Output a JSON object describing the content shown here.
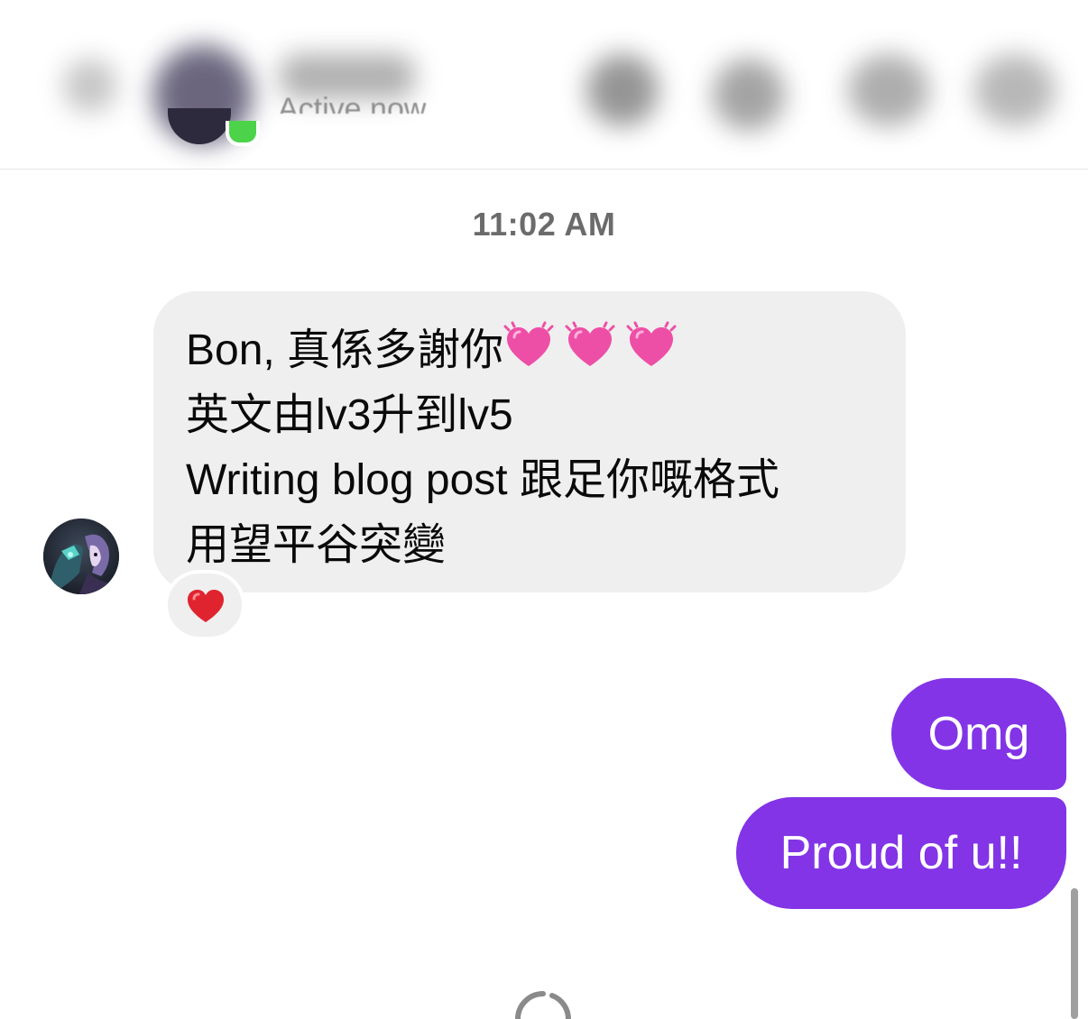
{
  "header": {
    "status": "Active now",
    "online_color": "#4cd34a",
    "icons": [
      "back-icon",
      "contact-avatar",
      "phone-icon",
      "video-icon",
      "info-icon",
      "more-icon"
    ]
  },
  "thread": {
    "timestamp": "11:02 AM",
    "incoming": {
      "lines": [
        "Bon, 真係多謝你",
        "英文由lv3升到lv5",
        "Writing blog post 跟足你嘅格式",
        "用望平谷突變"
      ],
      "trailing_emojis": [
        "growing-heart-icon",
        "growing-heart-icon",
        "growing-heart-icon"
      ],
      "reaction": "red-heart-icon",
      "bubble_color": "#efefef"
    },
    "outgoing": [
      {
        "text": "Omg"
      },
      {
        "text": "Proud of u!!"
      }
    ],
    "outgoing_color": "#8234e6"
  },
  "loading": {
    "spinner_icon": "loading-spinner-icon"
  }
}
